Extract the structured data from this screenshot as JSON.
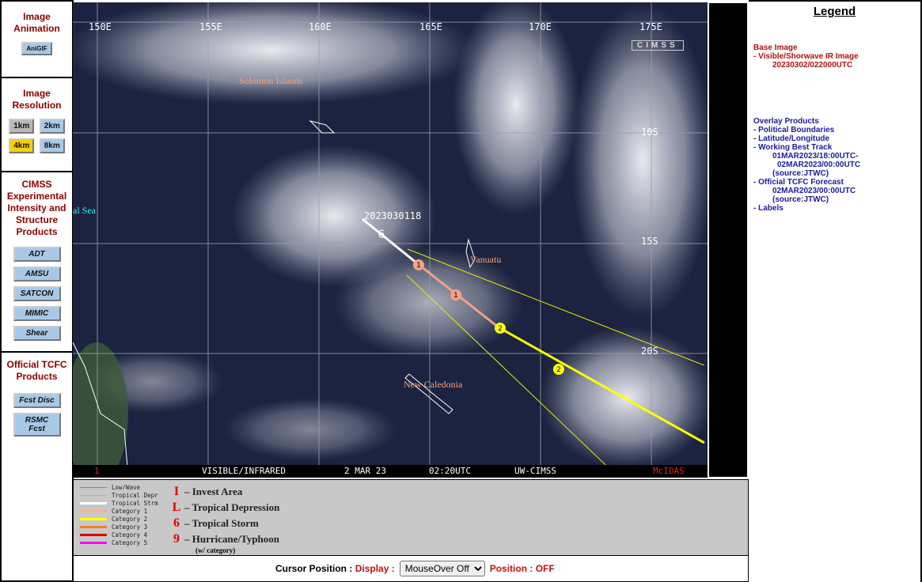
{
  "left_panel": {
    "animation": {
      "title": "Image Animation",
      "buttons": [
        "AniGIF"
      ]
    },
    "resolution": {
      "title": "Image Resolution",
      "buttons": [
        "1km",
        "2km",
        "4km",
        "8km"
      ],
      "selected": "4km"
    },
    "cimss": {
      "title": "CIMSS Experimental Intensity and Structure Products",
      "buttons": [
        "ADT",
        "AMSU",
        "SATCON",
        "MIMIC",
        "Shear"
      ]
    },
    "official": {
      "title": "Official TCFC Products",
      "buttons": [
        "Fcst Disc",
        "RSMC Fcst"
      ]
    }
  },
  "map": {
    "lon_labels": [
      "150E",
      "155E",
      "160E",
      "165E",
      "170E",
      "175E"
    ],
    "lat_labels": [
      "10S",
      "15S",
      "20S"
    ],
    "places": [
      "Solomon Islands",
      "Vanuatu",
      "New Caledonia",
      "al Sea"
    ],
    "track_label": "2023030118",
    "track_categories": [
      "1",
      "1",
      "2",
      "2"
    ],
    "status_bar": {
      "frame": "1",
      "product": "VISIBLE/INFRARED",
      "date": "2 MAR 23",
      "time": "02:20UTC",
      "source": "UW-CIMSS",
      "brand": "McIDAS"
    },
    "logo": "CIMSS",
    "colors": {
      "best_track_ts": "#ffffff",
      "cat1": "#f8a080",
      "cat2": "#ffff00",
      "cone": "#e8e800"
    }
  },
  "legend": {
    "title": "Legend",
    "base_heading": "Base Image",
    "base_item": "-  Visible/Shorwave IR Image",
    "base_time": "20230302/022000UTC",
    "overlay_heading": "Overlay Products",
    "overlay_items": [
      "-  Political Boundaries",
      "-  Latitude/Longitude",
      "-  Working Best Track",
      "01MAR2023/18:00UTC-",
      "02MAR2023/00:00UTC",
      "(source:JTWC)",
      "-  Official TCFC Forecast",
      "02MAR2023/00:00UTC",
      "(source:JTWC)",
      "-  Labels"
    ]
  },
  "track_legend": {
    "lines": [
      {
        "label": "Low/Wave",
        "color": "#888888"
      },
      {
        "label": "Tropical Depr",
        "color": "#40e0e0"
      },
      {
        "label": "Tropical Strm",
        "color": "#ffffff"
      },
      {
        "label": "Category 1",
        "color": "#f8b090"
      },
      {
        "label": "Category 2",
        "color": "#ffff00"
      },
      {
        "label": "Category 3",
        "color": "#f08020"
      },
      {
        "label": "Category 4",
        "color": "#e00000"
      },
      {
        "label": "Category 5",
        "color": "#ff00ff"
      }
    ],
    "symbols": [
      {
        "glyph": "I",
        "label": "– Invest Area"
      },
      {
        "glyph": "L",
        "label": "– Tropical Depression"
      },
      {
        "glyph": "6",
        "label": "– Tropical Storm"
      },
      {
        "glyph": "9",
        "label": "– Hurricane/Typhoon"
      }
    ],
    "note": "(w/ category)"
  },
  "cursor": {
    "label": "Cursor Position :",
    "display_label": "Display :",
    "display_value": "MouseOver Off",
    "position_label": "Position : OFF"
  }
}
